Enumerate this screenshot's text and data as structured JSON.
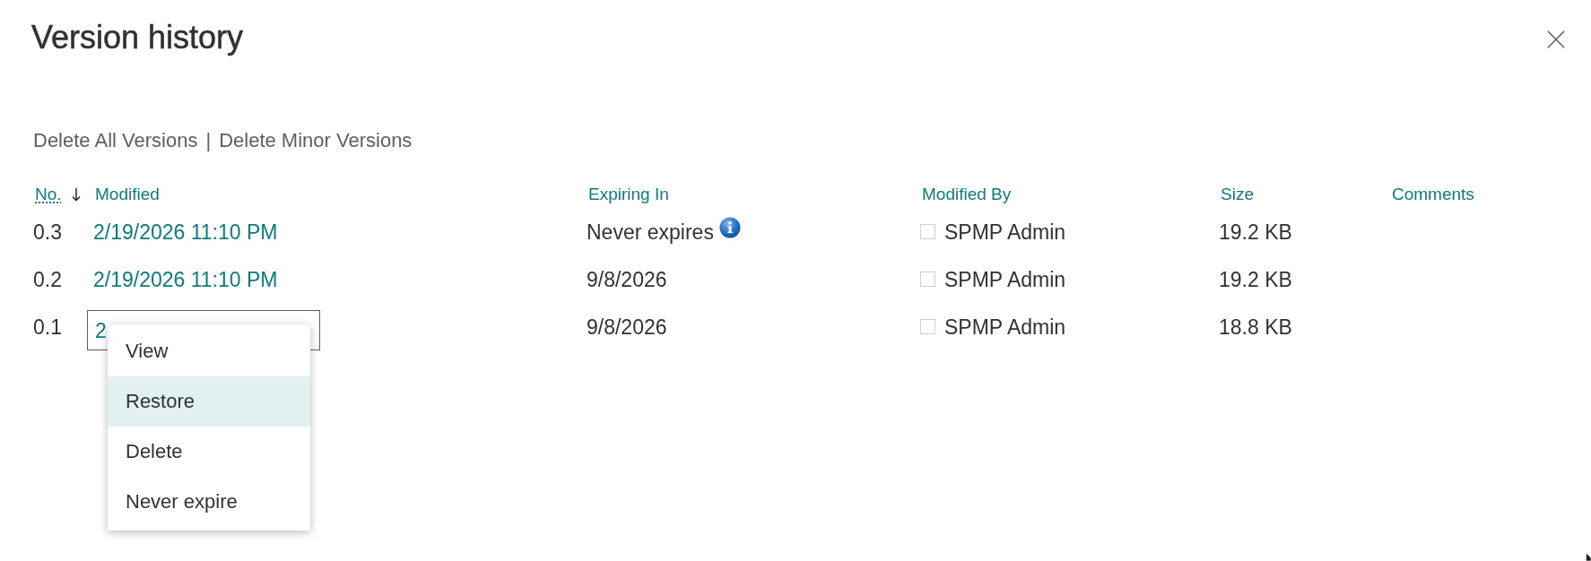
{
  "dialog": {
    "title": "Version history"
  },
  "actions": {
    "items": [
      "Delete All Versions",
      "Delete Minor Versions"
    ],
    "separator": "|"
  },
  "table": {
    "columns": [
      {
        "label": "No.",
        "sorted": true
      },
      {
        "label": "Modified",
        "sorted": false
      },
      {
        "label": "Expiring In",
        "sorted": false
      },
      {
        "label": "Modified By",
        "sorted": false
      },
      {
        "label": "Size",
        "sorted": false
      },
      {
        "label": "Comments",
        "sorted": false
      }
    ],
    "rows": [
      {
        "number": "0.3",
        "modified": "2/19/2026 11:10 PM",
        "expiring": "Never expires",
        "info": true,
        "checked": false,
        "modified_by": "SPMP Admin",
        "size": "19.2 KB",
        "focused": false
      },
      {
        "number": "0.2",
        "modified": "2/19/2026 11:10 PM",
        "expiring": "9/8/2026",
        "info": false,
        "checked": false,
        "modified_by": "SPMP Admin",
        "size": "19.2 KB",
        "focused": false
      },
      {
        "number": "0.1",
        "modified": "2",
        "expiring": "9/8/2026",
        "info": false,
        "checked": false,
        "modified_by": "SPMP Admin",
        "size": "18.8 KB",
        "focused": true
      }
    ]
  },
  "context_menu": {
    "items": [
      {
        "label": "View",
        "selected": false
      },
      {
        "label": "Restore",
        "selected": true
      },
      {
        "label": "Delete",
        "selected": false
      },
      {
        "label": "Never expire",
        "selected": false
      }
    ]
  }
}
